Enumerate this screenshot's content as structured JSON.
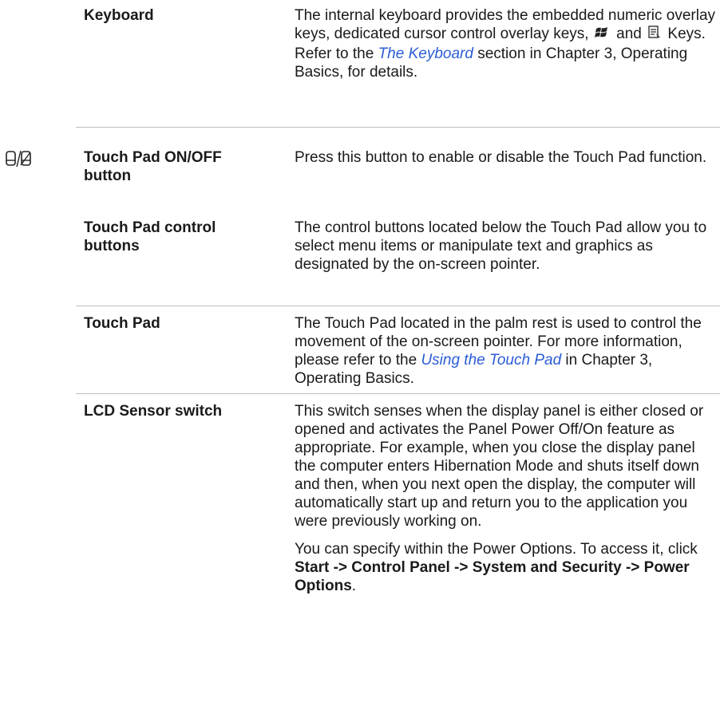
{
  "rows": [
    {
      "term": "Keyboard",
      "desc": {
        "t1": "The internal keyboard provides the embedded numeric overlay keys, dedicated cursor control overlay keys,",
        "t2": "and",
        "t3": "Keys. Refer to the",
        "link": "The Keyboard",
        "t4": "section in Chapter 3, Operating Basics, for details."
      },
      "icons": [
        "windows-key-icon",
        "application-key-icon"
      ]
    },
    {
      "term": "Touch Pad ON/OFF button",
      "desc": "Press this button to enable or disable the Touch Pad function.",
      "side_icon": "touchpad-toggle-icon"
    },
    {
      "term": "Touch Pad control buttons",
      "desc": "The control buttons located below the Touch Pad allow you to select menu items or manipulate text and graphics as designated by the on-screen pointer."
    },
    {
      "term": "Touch Pad",
      "desc": {
        "t1": "The Touch Pad located in the palm rest is used to control the movement of the on-screen pointer. For more information, please refer to the",
        "link": "Using the Touch Pad",
        "t2": "in Chapter 3, Operating Basics."
      }
    },
    {
      "term": "LCD Sensor switch",
      "desc_p1": "This switch senses when the display panel is either closed or opened and activates the Panel Power Off/On feature as appropriate. For example, when you close the display panel the computer enters Hibernation Mode and shuts itself down and then, when you next open the display, the computer will automatically start up and return you to the application you were previously working on.",
      "desc_p2": {
        "t1": "You can specify within the Power Options. To access it, click",
        "bold": "Start -> Control Panel -> System and Security -> Power Options",
        "t2": "."
      }
    }
  ],
  "colors": {
    "link": "#2b5cd6",
    "rule": "#bdbdbd"
  }
}
